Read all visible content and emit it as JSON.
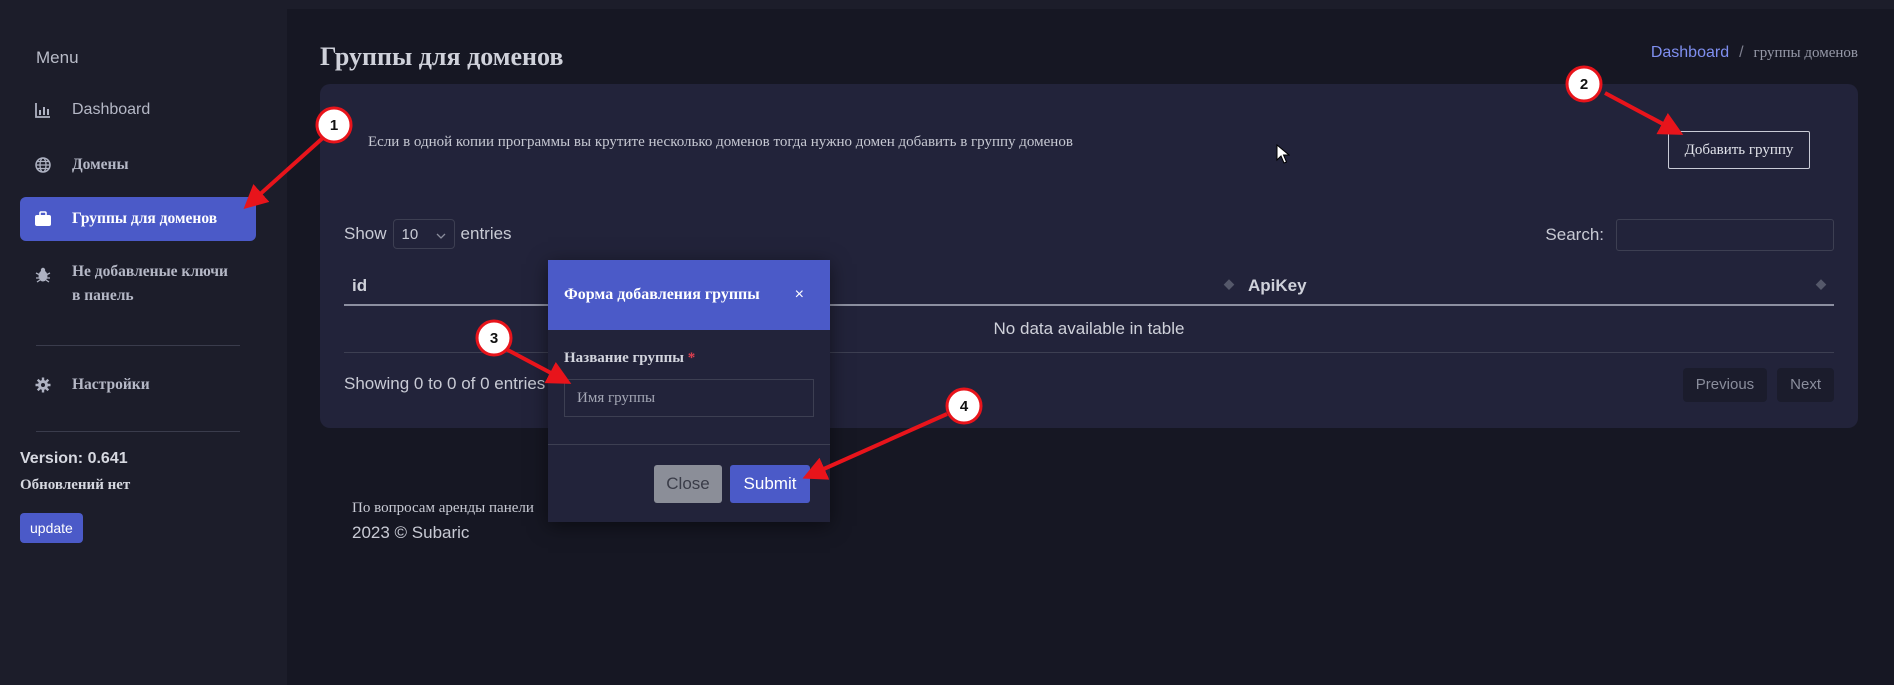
{
  "sidebar": {
    "menu_title": "Menu",
    "items": [
      {
        "label": "Dashboard",
        "icon": "bar-chart-icon"
      },
      {
        "label": "Домены",
        "icon": "globe-icon"
      },
      {
        "label": "Группы для доменов",
        "icon": "briefcase-icon",
        "active": true
      },
      {
        "label_line1": "Не добавленые ключи",
        "label_line2": "в панель",
        "icon": "bug-icon"
      },
      {
        "label": "Настройки",
        "icon": "gear-icon"
      }
    ],
    "version": "Version: 0.641",
    "update_status": "Обновлений нет",
    "update_button": "update"
  },
  "header": {
    "title": "Группы для доменов",
    "breadcrumb": {
      "home": "Dashboard",
      "separator": "/",
      "current": "группы доменов"
    }
  },
  "card": {
    "info_text": "Если в одной копии программы вы крутите несколько доменов тогда нужно домен добавить в группу доменов",
    "add_button": "Добавить группу"
  },
  "table": {
    "show_label": "Show",
    "entries_value": "10",
    "entries_label": "entries",
    "search_label": "Search:",
    "search_value": "",
    "columns": [
      "id",
      "ApiKey"
    ],
    "empty_message": "No data available in table",
    "info": "Showing 0 to 0 of 0 entries",
    "previous": "Previous",
    "next": "Next"
  },
  "footer": {
    "line1": "По вопросам аренды панели",
    "line2": "2023 © Subaric"
  },
  "modal": {
    "title": "Форма добавления группы",
    "close_symbol": "×",
    "field_label": "Название группы",
    "required_mark": "*",
    "field_placeholder": "Имя группы",
    "close_button": "Close",
    "submit_button": "Submit"
  },
  "annotations": {
    "markers": [
      "1",
      "2",
      "3",
      "4"
    ],
    "arrow_color": "#e8141b"
  },
  "colors": {
    "accent": "#4b5ac8",
    "background": "#161723",
    "sidebar": "#1c1d2a",
    "card": "#22233a"
  }
}
